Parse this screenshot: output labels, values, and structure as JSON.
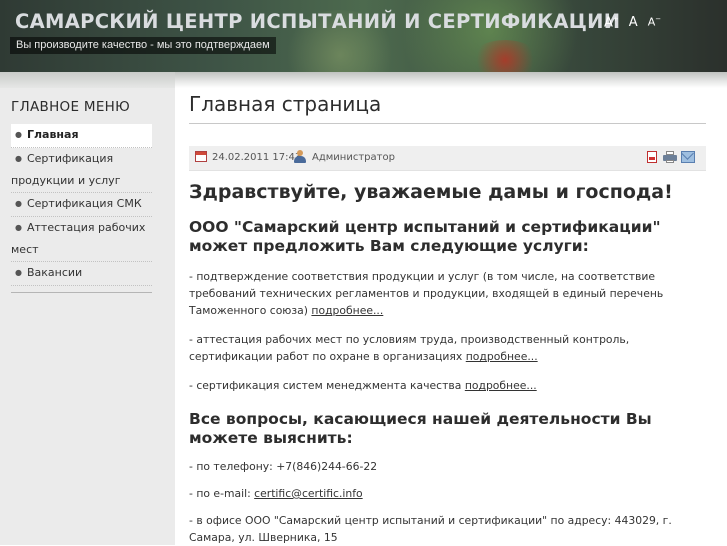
{
  "header": {
    "site_title": "САМАРСКИЙ ЦЕНТР ИСПЫТАНИЙ И СЕРТИФИКАЦИИ",
    "slogan": "Вы производите качество - мы это подтверждаем",
    "font_sizer": {
      "increase": "A",
      "increase_mark": "+",
      "reset": "A",
      "decrease": "A",
      "decrease_mark": "−"
    }
  },
  "sidebar": {
    "menu_title": "ГЛАВНОЕ МЕНЮ",
    "items": [
      {
        "label": "Главная",
        "active": true
      },
      {
        "label": "Сертификация продукции и услуг",
        "active": false
      },
      {
        "label": "Сертификация СМК",
        "active": false
      },
      {
        "label": "Аттестация рабочих мест",
        "active": false
      },
      {
        "label": "Вакансии",
        "active": false
      }
    ]
  },
  "article": {
    "page_title": "Главная страница",
    "date": "24.02.2011 17:43",
    "author": "Администратор",
    "greeting": "Здравствуйте, уважаемые дамы и господа!",
    "services_heading": "ООО \"Самарский центр испытаний и сертификации\" может предложить Вам следующие услуги:",
    "services": [
      {
        "text": "- подтверждение соответствия продукции и услуг (в том числе, на соответствие требований технических регламентов и продукции, входящей в единый перечень Таможенного союза) ",
        "link": "подробнее..."
      },
      {
        "text": "- аттестация рабочих мест по условиям труда, производственный контроль, сертификации работ по охране в организациях ",
        "link": "подробнее..."
      },
      {
        "text": "- сертификация систем менеджмента качества ",
        "link": "подробнее..."
      }
    ],
    "contact_heading": "Все вопросы, касающиеся нашей деятельности Вы можете выяснить:",
    "phone": "- по телефону: +7(846)244-66-22",
    "email_prefix": "- по e-mail: ",
    "email": "certific@certific.info",
    "office": "- в офисе ООО \"Самарский центр испытаний и сертификации\" по адресу: 443029, г. Самара, ул. Шверника, 15"
  },
  "icons": {
    "date": "calendar-icon",
    "author": "user-icon",
    "pdf": "pdf-icon",
    "print": "print-icon",
    "email": "email-icon"
  },
  "colors": {
    "header_text": "#d9dcdf",
    "sidebar_bg": "#ebebeb",
    "meta_bar_bg": "#efefef",
    "text": "#333333"
  }
}
